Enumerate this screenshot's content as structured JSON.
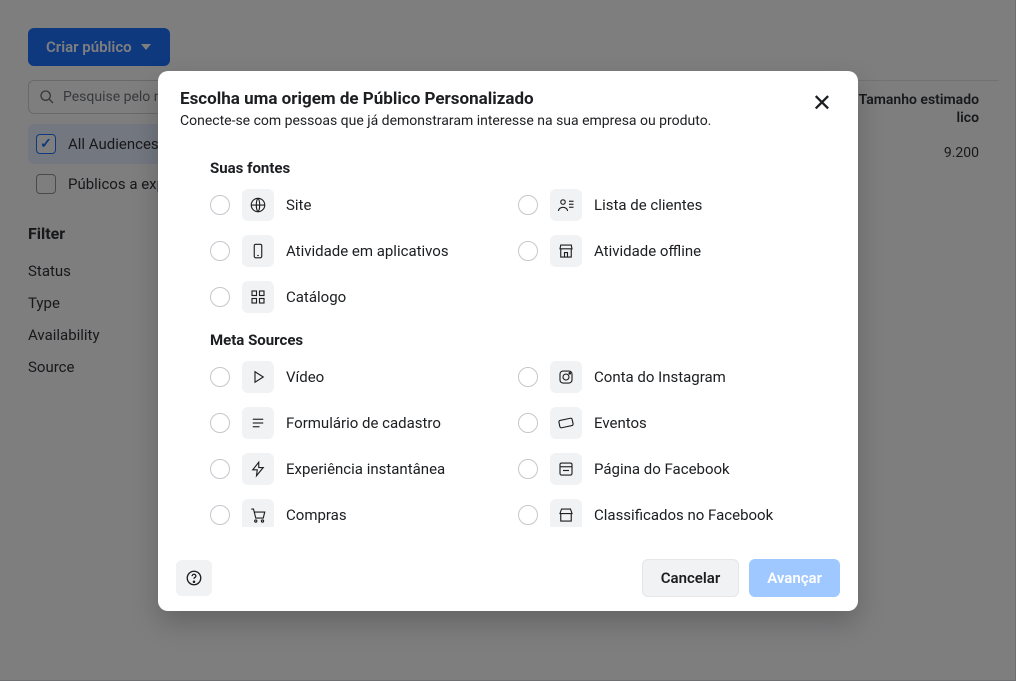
{
  "header": {
    "create_button": "Criar público"
  },
  "sidebar": {
    "search_placeholder": "Pesquise pelo nome ou identific",
    "audiences": {
      "all": "All Audiences",
      "expiring": "Públicos a expirar"
    },
    "filter_heading": "Filter",
    "filters": {
      "status": "Status",
      "type": "Type",
      "availability": "Availability",
      "source": "Source"
    }
  },
  "table": {
    "size_header_line1": "Tamanho estimado",
    "size_header_line2": "lico",
    "size_value": "9.200"
  },
  "modal": {
    "title": "Escolha uma origem de Público Personalizado",
    "subtitle": "Conecte-se com pessoas que já demonstraram interesse na sua empresa ou produto.",
    "sections": {
      "your_sources": "Suas fontes",
      "meta_sources": "Meta Sources"
    },
    "options": {
      "site": "Site",
      "customer_list": "Lista de clientes",
      "app_activity": "Atividade em aplicativos",
      "offline_activity": "Atividade offline",
      "catalog": "Catálogo",
      "video": "Vídeo",
      "instagram": "Conta do Instagram",
      "lead_form": "Formulário de cadastro",
      "events": "Eventos",
      "instant_experience": "Experiência instantânea",
      "facebook_page": "Página do Facebook",
      "shopping": "Compras",
      "marketplace": "Classificados no Facebook"
    },
    "footer": {
      "cancel": "Cancelar",
      "next": "Avançar"
    }
  }
}
